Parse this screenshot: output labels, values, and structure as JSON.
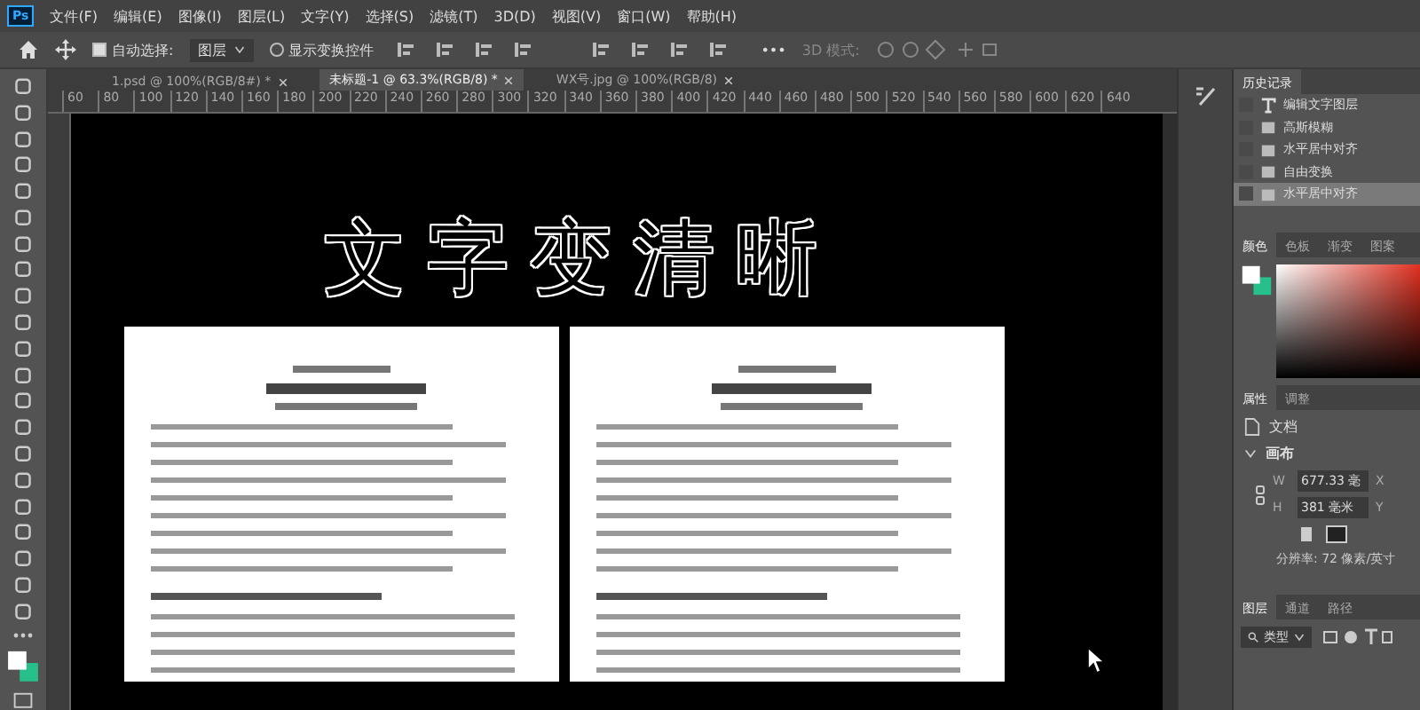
{
  "app_logo": "Ps",
  "menu": [
    "文件(F)",
    "编辑(E)",
    "图像(I)",
    "图层(L)",
    "文字(Y)",
    "选择(S)",
    "滤镜(T)",
    "3D(D)",
    "视图(V)",
    "窗口(W)",
    "帮助(H)"
  ],
  "options_bar": {
    "auto_select": {
      "label": "自动选择:",
      "checked": true
    },
    "target": "图层",
    "show_transform": {
      "label": "显示变换控件",
      "checked": false
    },
    "more": "•••",
    "mode_3d": "3D 模式:"
  },
  "doc_tabs": [
    {
      "label": "1.psd @ 100%(RGB/8#) *",
      "selected": false
    },
    {
      "label": "未标题-1 @ 63.3%(RGB/8) *",
      "selected": true
    },
    {
      "label": "WX号.jpg @ 100%(RGB/8)",
      "selected": false
    }
  ],
  "ruler": [
    "60",
    "80",
    "100",
    "120",
    "140",
    "160",
    "180",
    "200",
    "220",
    "240",
    "260",
    "280",
    "300",
    "320",
    "340",
    "360",
    "380",
    "400",
    "420",
    "440",
    "460",
    "480",
    "500",
    "520",
    "540",
    "560",
    "580",
    "600",
    "620",
    "640"
  ],
  "canvas": {
    "title": "文字变清晰"
  },
  "history": {
    "tab": "历史记录",
    "items": [
      {
        "kind": "text",
        "label": "编辑文字图层",
        "selected": false
      },
      {
        "kind": "doc",
        "label": "高斯模糊",
        "selected": false
      },
      {
        "kind": "doc",
        "label": "水平居中对齐",
        "selected": false
      },
      {
        "kind": "doc",
        "label": "自由变换",
        "selected": false
      },
      {
        "kind": "doc",
        "label": "水平居中对齐",
        "selected": true
      }
    ]
  },
  "color_tabs": [
    {
      "label": "颜色",
      "selected": true
    },
    {
      "label": "色板",
      "selected": false
    },
    {
      "label": "渐变",
      "selected": false
    },
    {
      "label": "图案",
      "selected": false
    }
  ],
  "properties": {
    "tabs": [
      {
        "label": "属性",
        "selected": true
      },
      {
        "label": "调整",
        "selected": false
      }
    ],
    "doc_label": "文档",
    "section": {
      "label": "画布",
      "expanded": true
    },
    "w_label": "W",
    "w": "677.33 毫",
    "x_label": "X",
    "h_label": "H",
    "h": "381 毫米",
    "y_label": "Y",
    "resolution": "分辨率: 72 像素/英寸"
  },
  "layers": {
    "tabs": [
      {
        "label": "图层",
        "selected": true
      },
      {
        "label": "通道",
        "selected": false
      },
      {
        "label": "路径",
        "selected": false
      }
    ],
    "filter": "类型"
  }
}
